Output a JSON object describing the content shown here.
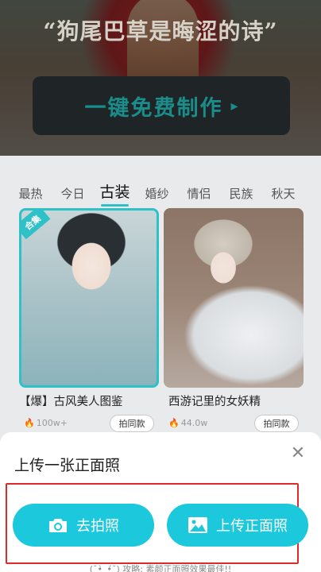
{
  "hero": {
    "title": "“狗尾巴草是晦涩的诗”",
    "cta_label": "一键免费制作",
    "cta_arrow": "▸"
  },
  "tabs": [
    "最热",
    "今日",
    "古装",
    "婚纱",
    "情侣",
    "民族",
    "秋天"
  ],
  "active_tab": "古装",
  "cards": [
    {
      "badge": "合集",
      "title": "【爆】古风美人图鉴",
      "count": "100w+",
      "action": "拍同款"
    },
    {
      "title": "西游记里的女妖精",
      "count": "44.0w",
      "action": "拍同款"
    }
  ],
  "sheet": {
    "title": "上传一张正面照",
    "close_icon": "close-icon",
    "camera_button": "去拍照",
    "upload_button": "上传正面照",
    "hint": "(˘•̀_•́˘) 攻略: 素颜正面照效果最佳!!"
  },
  "colors": {
    "accent": "#1cc8dc",
    "tab_underline": "#2ec1c8",
    "cta_text": "#1a8c8a",
    "highlight": "#e02a2a",
    "fire": "#f06b2a"
  }
}
